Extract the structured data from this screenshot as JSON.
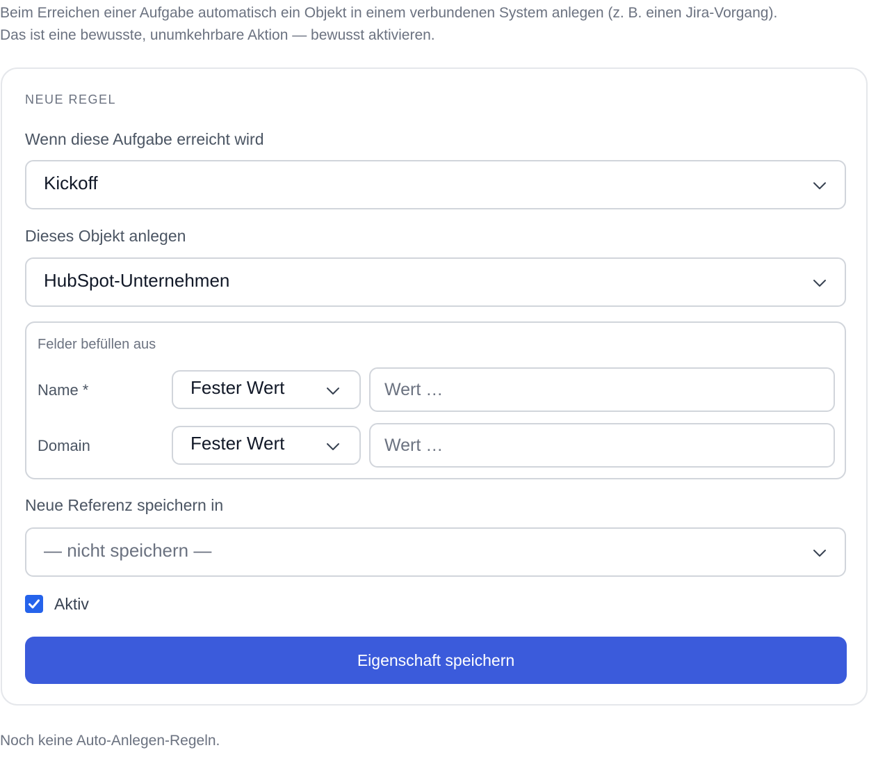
{
  "intro": {
    "line1": "Beim Erreichen einer Aufgabe automatisch ein Objekt in einem verbundenen System anlegen (z. B. einen Jira-Vorgang).",
    "line2": "Das ist eine bewusste, unumkehrbare Aktion — bewusst aktivieren."
  },
  "form": {
    "section_title": "NEUE REGEL",
    "trigger": {
      "label": "Wenn diese Aufgabe erreicht wird",
      "selected": "Kickoff"
    },
    "object": {
      "label": "Dieses Objekt anlegen",
      "selected": "HubSpot-Unternehmen"
    },
    "mapping": {
      "title": "Felder befüllen aus",
      "rows": [
        {
          "field": "Name *",
          "source": "Fester Wert",
          "value_placeholder": "Wert …"
        },
        {
          "field": "Domain",
          "source": "Fester Wert",
          "value_placeholder": "Wert …"
        }
      ]
    },
    "reference": {
      "label": "Neue Referenz speichern in",
      "selected": "— nicht speichern —"
    },
    "active": {
      "label": "Aktiv",
      "checked": true
    },
    "submit_label": "Eigenschaft speichern"
  },
  "empty_state": "Noch keine Auto-Anlegen-Regeln.",
  "icons": {
    "select_arrow": "chevron-down-icon",
    "checkbox_mark": "check-icon"
  },
  "colors": {
    "primary": "#3b5bdb",
    "checkbox": "#2563eb",
    "border": "#d1d5db",
    "muted_text": "#6b7280"
  }
}
